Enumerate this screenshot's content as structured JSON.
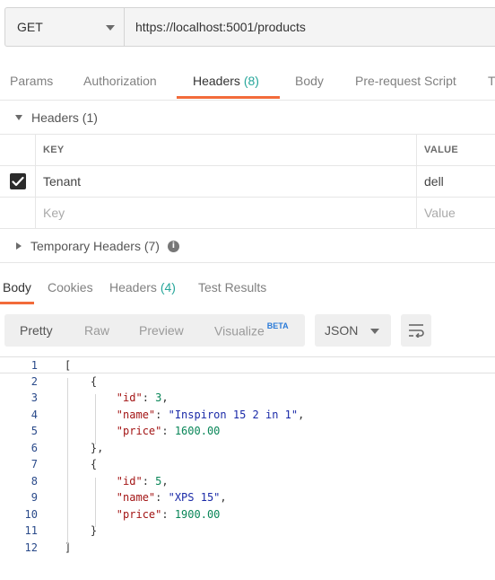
{
  "request": {
    "method": "GET",
    "url": "https://localhost:5001/products"
  },
  "request_tabs": [
    {
      "label": "Params",
      "count": ""
    },
    {
      "label": "Authorization",
      "count": ""
    },
    {
      "label": "Headers",
      "count": "(8)"
    },
    {
      "label": "Body",
      "count": ""
    },
    {
      "label": "Pre-request Script",
      "count": ""
    },
    {
      "label": "T",
      "count": ""
    }
  ],
  "headers_section": {
    "title": "Headers (1)",
    "columns": {
      "key": "KEY",
      "value": "VALUE"
    },
    "rows": [
      {
        "checked": true,
        "key": "Tenant",
        "value": "dell"
      }
    ],
    "new_row": {
      "key_placeholder": "Key",
      "value_placeholder": "Value"
    },
    "temporary_title": "Temporary Headers (7)"
  },
  "response_tabs": [
    {
      "label": "Body",
      "count": ""
    },
    {
      "label": "Cookies",
      "count": ""
    },
    {
      "label": "Headers",
      "count": "(4)"
    },
    {
      "label": "Test Results",
      "count": ""
    }
  ],
  "view_modes": {
    "pretty": "Pretty",
    "raw": "Raw",
    "preview": "Preview",
    "visualize": "Visualize",
    "beta": "BETA"
  },
  "format": "JSON",
  "code_lines": [
    {
      "n": "1",
      "text": "["
    },
    {
      "n": "2",
      "text": "    {"
    },
    {
      "n": "3",
      "text": "        \"id\": 3,"
    },
    {
      "n": "4",
      "text": "        \"name\": \"Inspiron 15 2 in 1\","
    },
    {
      "n": "5",
      "text": "        \"price\": 1600.00"
    },
    {
      "n": "6",
      "text": "    },"
    },
    {
      "n": "7",
      "text": "    {"
    },
    {
      "n": "8",
      "text": "        \"id\": 5,"
    },
    {
      "n": "9",
      "text": "        \"name\": \"XPS 15\","
    },
    {
      "n": "10",
      "text": "        \"price\": 1900.00"
    },
    {
      "n": "11",
      "text": "    }"
    },
    {
      "n": "12",
      "text": "]"
    }
  ],
  "colors": {
    "accent": "#f26b3a",
    "count": "#26a69a",
    "beta": "#2a7bd8"
  }
}
